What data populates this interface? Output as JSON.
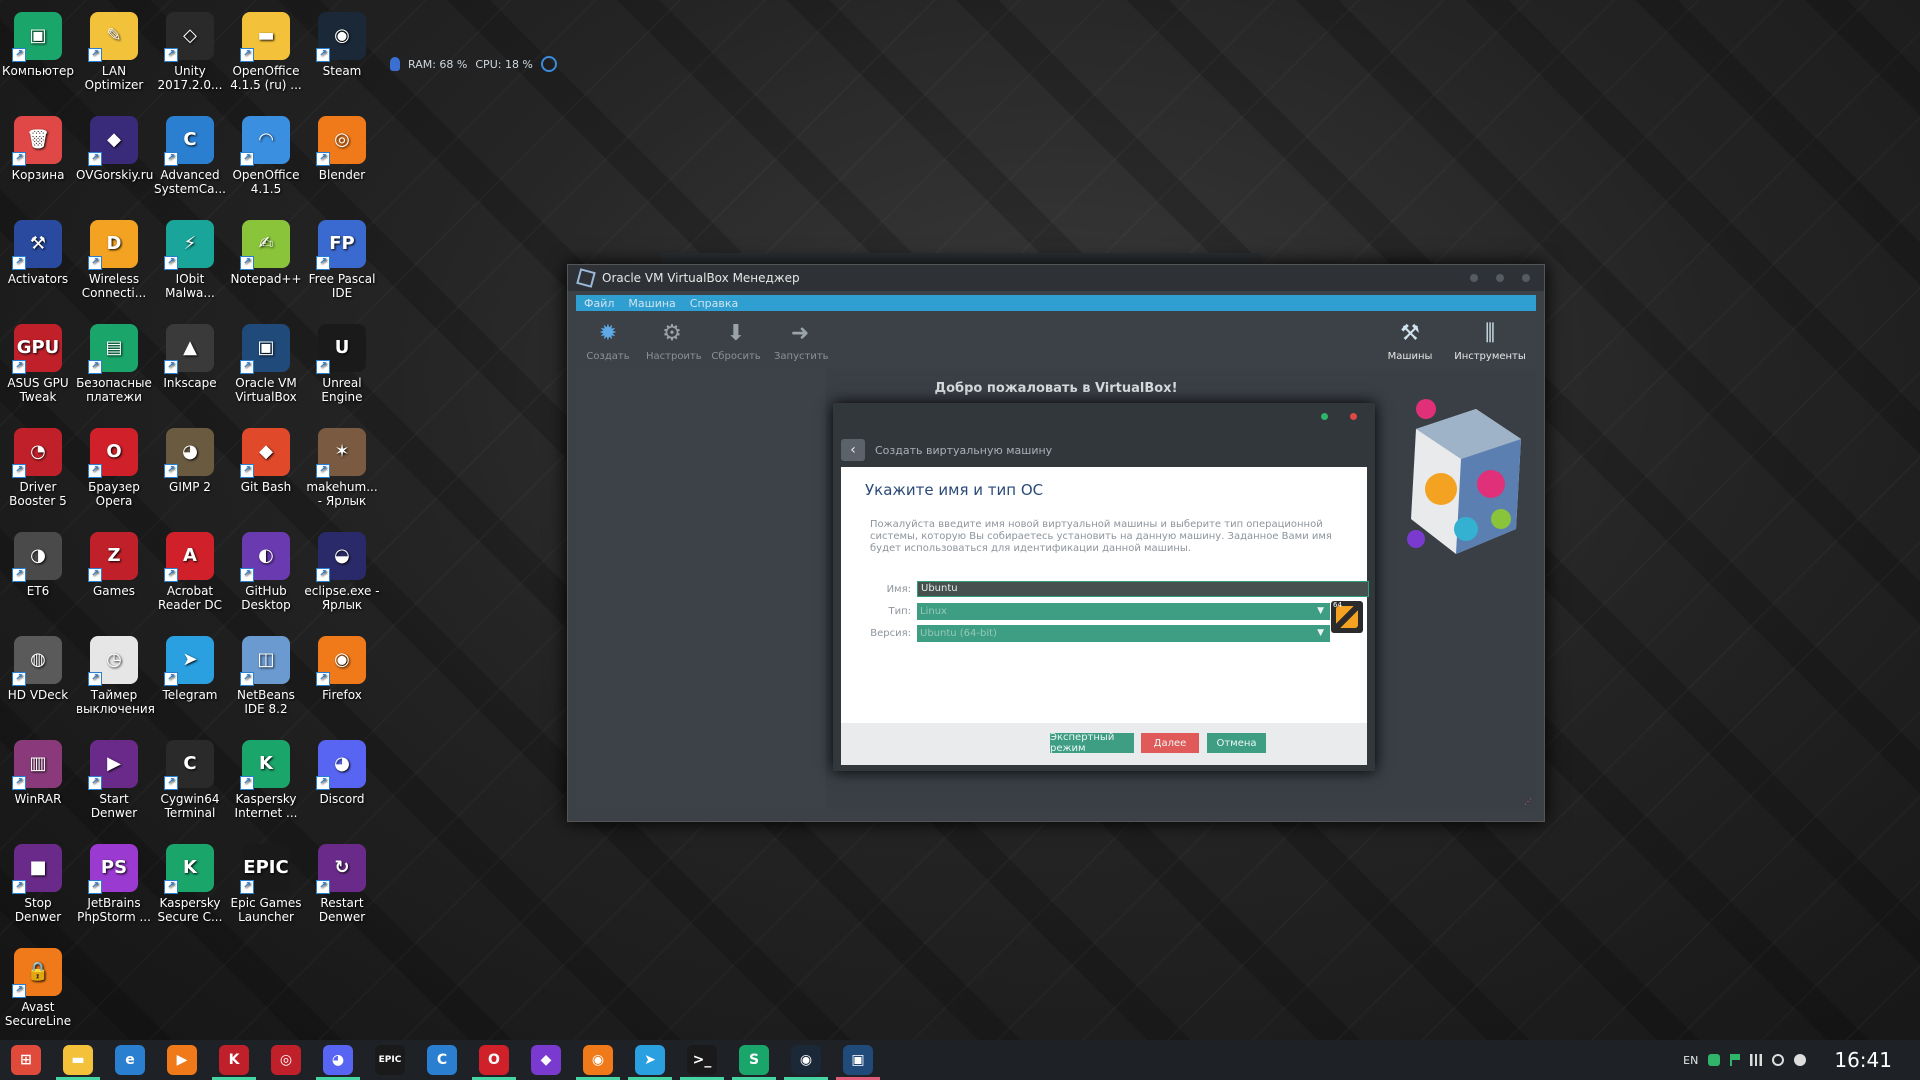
{
  "desktop": {
    "icons": [
      {
        "label": "Компьютер",
        "glyph": "▣",
        "color": "#1aa56a"
      },
      {
        "label": "LAN Optimizer",
        "glyph": "✎",
        "color": "#f2c23a"
      },
      {
        "label": "Unity 2017.2.0...",
        "glyph": "◇",
        "color": "#2a2a2a"
      },
      {
        "label": "OpenOffice 4.1.5 (ru) ...",
        "glyph": "▬",
        "color": "#f3c23a"
      },
      {
        "label": "Steam",
        "glyph": "◉",
        "color": "#1b2838"
      },
      {
        "label": "Корзина",
        "glyph": "🗑",
        "color": "#e04848"
      },
      {
        "label": "OVGorskiy.ru",
        "glyph": "◆",
        "color": "#3a2a7a"
      },
      {
        "label": "Advanced SystemCa...",
        "glyph": "C",
        "color": "#2a7fd0"
      },
      {
        "label": "OpenOffice 4.1.5",
        "glyph": "◠",
        "color": "#3a8fe0"
      },
      {
        "label": "Blender",
        "glyph": "◎",
        "color": "#f07a1a"
      },
      {
        "label": "Activators",
        "glyph": "⚒",
        "color": "#2a4aa0"
      },
      {
        "label": "Wireless Connecti...",
        "glyph": "D",
        "color": "#f3a321"
      },
      {
        "label": "IObit Malwa...",
        "glyph": "⚡",
        "color": "#1aa59a"
      },
      {
        "label": "Notepad++",
        "glyph": "✍",
        "color": "#8ac43a"
      },
      {
        "label": "Free Pascal IDE",
        "glyph": "FP",
        "color": "#3a6ad0"
      },
      {
        "label": "ASUS GPU Tweak",
        "glyph": "GPU",
        "color": "#c0202a"
      },
      {
        "label": "Безопасные платежи",
        "glyph": "▤",
        "color": "#1aa56a"
      },
      {
        "label": "Inkscape",
        "glyph": "▲",
        "color": "#3a3a3a"
      },
      {
        "label": "Oracle VM VirtualBox",
        "glyph": "▣",
        "color": "#1f4a7a"
      },
      {
        "label": "Unreal Engine",
        "glyph": "U",
        "color": "#1a1a1a"
      },
      {
        "label": "Driver Booster 5",
        "glyph": "◔",
        "color": "#c0202a"
      },
      {
        "label": "Браузер Opera",
        "glyph": "O",
        "color": "#d0202a"
      },
      {
        "label": "GIMP 2",
        "glyph": "◕",
        "color": "#6a5a40"
      },
      {
        "label": "Git Bash",
        "glyph": "◆",
        "color": "#e04a2a"
      },
      {
        "label": "makehum... - Ярлык",
        "glyph": "✶",
        "color": "#7a5a40"
      },
      {
        "label": "ET6",
        "glyph": "◑",
        "color": "#4a4a4a"
      },
      {
        "label": "Games",
        "glyph": "Z",
        "color": "#c0202a"
      },
      {
        "label": "Acrobat Reader DC",
        "glyph": "A",
        "color": "#d0202a"
      },
      {
        "label": "GitHub Desktop",
        "glyph": "◐",
        "color": "#6a3ab0"
      },
      {
        "label": "eclipse.exe - Ярлык",
        "glyph": "◒",
        "color": "#2a2a6a"
      },
      {
        "label": "HD VDeck",
        "glyph": "◍",
        "color": "#5a5a5a"
      },
      {
        "label": "Таймер выключения",
        "glyph": "◷",
        "color": "#e6e6e6"
      },
      {
        "label": "Telegram",
        "glyph": "➤",
        "color": "#2aa0e0"
      },
      {
        "label": "NetBeans IDE 8.2",
        "glyph": "◫",
        "color": "#6a9ad0"
      },
      {
        "label": "Firefox",
        "glyph": "◉",
        "color": "#f07a1a"
      },
      {
        "label": "WinRAR",
        "glyph": "▥",
        "color": "#8a3a7a"
      },
      {
        "label": "Start Denwer",
        "glyph": "▶",
        "color": "#6a2a8a"
      },
      {
        "label": "Cygwin64 Terminal",
        "glyph": "C",
        "color": "#2a2a2a"
      },
      {
        "label": "Kaspersky Internet ...",
        "glyph": "K",
        "color": "#1aa56a"
      },
      {
        "label": "Discord",
        "glyph": "◕",
        "color": "#5865f2"
      },
      {
        "label": "Stop Denwer",
        "glyph": "■",
        "color": "#6a2a8a"
      },
      {
        "label": "JetBrains PhpStorm ...",
        "glyph": "PS",
        "color": "#9a3ad0"
      },
      {
        "label": "Kaspersky Secure C...",
        "glyph": "K",
        "color": "#1aa56a"
      },
      {
        "label": "Epic Games Launcher",
        "glyph": "EPIC",
        "color": "#1a1a1a"
      },
      {
        "label": "Restart Denwer",
        "glyph": "↻",
        "color": "#6a2a8a"
      },
      {
        "label": "Avast SecureLine",
        "glyph": "🔒",
        "color": "#f07a1a"
      }
    ]
  },
  "sysmon": {
    "ram": "RAM: 68 %",
    "cpu": "CPU: 18 %"
  },
  "vbox": {
    "title": "Oracle VM VirtualBox Менеджер",
    "menu": [
      "Файл",
      "Машина",
      "Справка"
    ],
    "tools": [
      "Создать",
      "Настроить",
      "Сбросить",
      "Запустить"
    ],
    "right_tools": [
      "Машины",
      "Инструменты"
    ],
    "welcome": "Добро пожаловать в VirtualBox!"
  },
  "wizard": {
    "header": "Создать виртуальную машину",
    "heading": "Укажите имя и тип ОС",
    "description": "Пожалуйста введите имя новой виртуальной машины и выберите тип операционной системы, которую Вы собираетесь установить на данную машину. Заданное Вами имя будет использоваться для идентификации данной машины.",
    "name_label": "Имя:",
    "name_value": "Ubuntu",
    "type_label": "Тип:",
    "type_value": "Linux",
    "version_label": "Версия:",
    "version_value": "Ubuntu (64-bit)",
    "os_bits": "64",
    "buttons": {
      "expert": "Экспертный режим",
      "next": "Далее",
      "cancel": "Отмена"
    },
    "colors": {
      "expert": "#3d9e83",
      "next": "#e05a5a",
      "cancel": "#3d9e83"
    }
  },
  "taskbar": {
    "items": [
      {
        "name": "start",
        "glyph": "⊞",
        "color": "#e04a3a"
      },
      {
        "name": "explorer",
        "glyph": "▬",
        "color": "#f3c23a"
      },
      {
        "name": "ie",
        "glyph": "e",
        "color": "#2a7fd0"
      },
      {
        "name": "media",
        "glyph": "▶",
        "color": "#f07a1a"
      },
      {
        "name": "kaspersky",
        "glyph": "K",
        "color": "#c0202a"
      },
      {
        "name": "driver-booster",
        "glyph": "◎",
        "color": "#c0202a"
      },
      {
        "name": "discord",
        "glyph": "◕",
        "color": "#5865f2"
      },
      {
        "name": "epic",
        "glyph": "EPIC",
        "color": "#1a1a1a"
      },
      {
        "name": "advanced-systemcare",
        "glyph": "C",
        "color": "#2a7fd0"
      },
      {
        "name": "opera",
        "glyph": "O",
        "color": "#d0202a"
      },
      {
        "name": "visual-studio",
        "glyph": "◆",
        "color": "#7a3ad0"
      },
      {
        "name": "firefox",
        "glyph": "◉",
        "color": "#f07a1a"
      },
      {
        "name": "telegram",
        "glyph": "➤",
        "color": "#2aa0e0"
      },
      {
        "name": "terminal",
        "glyph": ">_",
        "color": "#1a1a1a"
      },
      {
        "name": "s-app",
        "glyph": "S",
        "color": "#1aa56a"
      },
      {
        "name": "steam",
        "glyph": "◉",
        "color": "#1b2838"
      },
      {
        "name": "virtualbox",
        "glyph": "▣",
        "color": "#1f4a7a"
      }
    ],
    "lang": "EN",
    "time": "16:41"
  }
}
